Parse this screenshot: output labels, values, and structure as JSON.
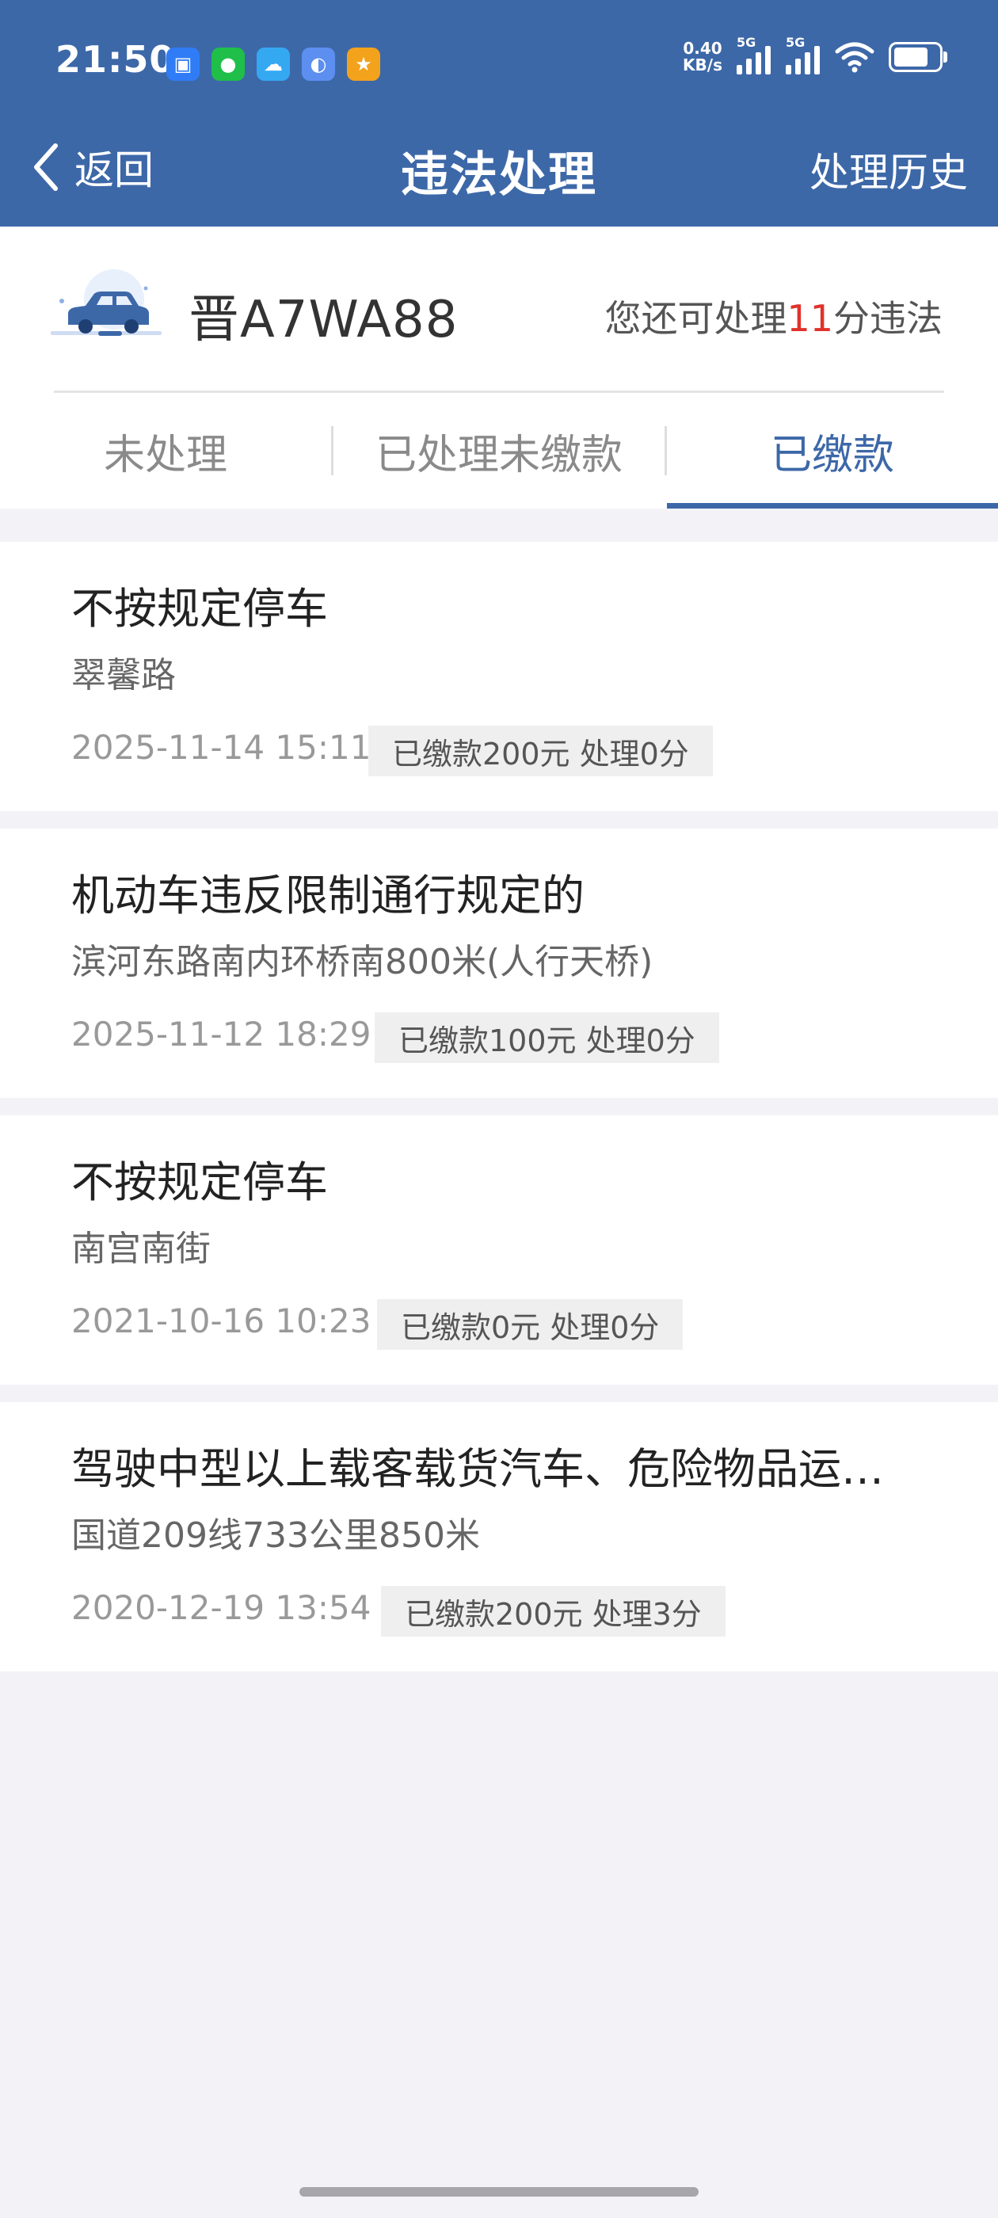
{
  "status_bar": {
    "time": "21:50",
    "net_speed_value": "0.40",
    "net_speed_unit": "KB/s",
    "signal_1": "5G",
    "signal_2": "5G",
    "app_icons": [
      "qr-app-icon",
      "wechat-icon",
      "weather-icon",
      "browser-icon",
      "star-app-icon"
    ]
  },
  "nav": {
    "back_label": "返回",
    "title": "违法处理",
    "history_label": "处理历史"
  },
  "vehicle": {
    "plate": "晋A7WA88",
    "points_prefix": "您还可处理",
    "points_value": "11",
    "points_suffix": "分违法"
  },
  "tabs": [
    {
      "label": "未处理",
      "active": false
    },
    {
      "label": "已处理未缴款",
      "active": false
    },
    {
      "label": "已缴款",
      "active": true
    }
  ],
  "violations": [
    {
      "title": "不按规定停车",
      "location": "翠馨路",
      "datetime": "2025-11-14 15:11",
      "status": "已缴款200元 处理0分"
    },
    {
      "title": "机动车违反限制通行规定的",
      "location": "滨河东路南内环桥南800米(人行天桥)",
      "datetime": "2025-11-12 18:29",
      "status": "已缴款100元 处理0分"
    },
    {
      "title": "不按规定停车",
      "location": "南宫南街",
      "datetime": "2021-10-16 10:23",
      "status": "已缴款0元 处理0分"
    },
    {
      "title": "驾驶中型以上载客载货汽车、危险物品运…",
      "location": "国道209线733公里850米",
      "datetime": "2020-12-19 13:54",
      "status": "已缴款200元 处理3分"
    }
  ],
  "colors": {
    "primary": "#3d68a8",
    "points_highlight": "#e0322a",
    "page_background": "#f3f3f7"
  }
}
